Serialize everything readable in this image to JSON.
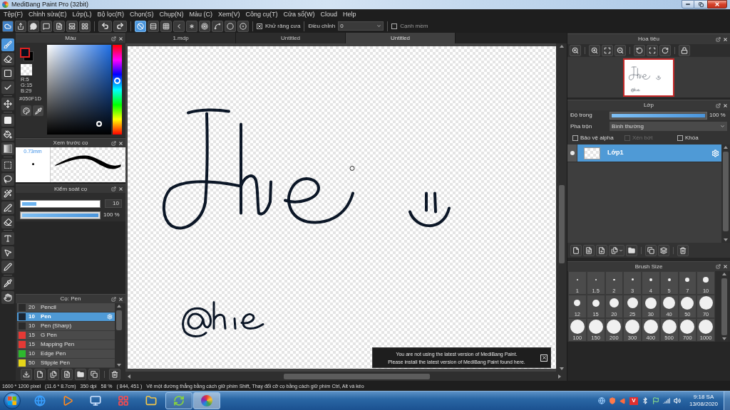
{
  "window": {
    "title": "MediBang Paint Pro (32bit)"
  },
  "menu": [
    "Tệp(F)",
    "Chỉnh sửa(E)",
    "Lớp(L)",
    "Bộ lọc(R)",
    "Chọn(S)",
    "Chụp(N)",
    "Màu (C)",
    "Xem(V)",
    "Công cụ(T)",
    "Cửa sổ(W)",
    "Cloud",
    "Help"
  ],
  "toolbar": {
    "snaps": [
      {
        "kind": "none",
        "selected": true
      },
      {
        "kind": "parallel",
        "selected": false
      },
      {
        "kind": "grid",
        "selected": false
      },
      {
        "kind": "perspective",
        "selected": false
      },
      {
        "kind": "radial",
        "selected": false
      },
      {
        "kind": "concentric",
        "selected": false
      },
      {
        "kind": "curve",
        "selected": false
      },
      {
        "kind": "circle",
        "selected": false
      },
      {
        "kind": "ellipse",
        "selected": false
      }
    ],
    "antialias": {
      "label": "Khử răng cưa",
      "checked": true
    },
    "correction": {
      "label": "Điều chỉnh",
      "value": "0"
    },
    "soft_edge": {
      "label": "Cạnh mềm",
      "checked": false
    }
  },
  "tool_groups": [
    [
      {
        "kind": "brush",
        "selected": true
      },
      {
        "kind": "eraser",
        "selected": false
      },
      {
        "kind": "dot",
        "selected": false
      },
      {
        "kind": "check",
        "selected": false
      }
    ],
    [
      {
        "kind": "move",
        "selected": false
      }
    ],
    [
      {
        "kind": "fill",
        "selected": false
      },
      {
        "kind": "bucket",
        "selected": false
      },
      {
        "kind": "gradient",
        "selected": false
      }
    ],
    [
      {
        "kind": "select",
        "selected": false
      },
      {
        "kind": "lasso",
        "selected": false
      },
      {
        "kind": "wand",
        "selected": false
      },
      {
        "kind": "select-pen",
        "selected": false
      },
      {
        "kind": "select-eraser",
        "selected": false
      }
    ],
    [
      {
        "kind": "text",
        "selected": false
      },
      {
        "kind": "pointer",
        "selected": false
      },
      {
        "kind": "pen",
        "selected": false
      }
    ],
    [
      {
        "kind": "eyedropper",
        "selected": false
      },
      {
        "kind": "hand",
        "selected": false
      }
    ]
  ],
  "color_panel": {
    "title": "Màu",
    "r": "R:5",
    "g": "G:15",
    "b": "B:29",
    "hex": "#050F1D",
    "hue_slider": {
      "level": 0.6
    }
  },
  "brush_preview": {
    "title": "Xem trước cọ",
    "size": "0.73mm"
  },
  "brush_control": {
    "title": "Kiểm soát cọ",
    "size": {
      "level": 0.19,
      "value": "10"
    },
    "opacity": {
      "level": 1,
      "reading": "100 %"
    }
  },
  "brush_list": {
    "title": "Cọ: Pen",
    "items": [
      {
        "size": "20",
        "name": "Pencil",
        "color": "#2b2b2b",
        "selected": false
      },
      {
        "size": "10",
        "name": "Pen",
        "color": "#1b2634",
        "selected": true
      },
      {
        "size": "10",
        "name": "Pen (Sharp)",
        "color": "#2b2b2b",
        "selected": false
      },
      {
        "size": "15",
        "name": "G Pen",
        "color": "#e53935",
        "selected": false
      },
      {
        "size": "15",
        "name": "Mapping Pen",
        "color": "#e53935",
        "selected": false
      },
      {
        "size": "10",
        "name": "Edge Pen",
        "color": "#2eb82e",
        "selected": false
      },
      {
        "size": "50",
        "name": "Stipple Pen",
        "color": "#e6d619",
        "selected": false
      }
    ]
  },
  "document_tabs": [
    {
      "label": "1.mdp",
      "selected": false
    },
    {
      "label": "Untitled",
      "selected": false
    },
    {
      "label": "Untitled",
      "selected": true
    }
  ],
  "notification": {
    "lines": [
      "You are not using the latest version of MediBang Paint.",
      "Please install the latest version of MediBang Paint found here."
    ]
  },
  "navigator": {
    "title": "Hoa tiêu"
  },
  "layer_panel": {
    "title": "Lớp",
    "opacity": {
      "label": "Độ trong",
      "level": 1,
      "reading": "100 %"
    },
    "blend": {
      "label": "Pha trộn",
      "value": "Bình thường"
    },
    "options": [
      {
        "label": "Bảo vệ alpha",
        "checked": false,
        "disabled": false
      },
      {
        "label": "Xén bớt",
        "checked": false,
        "disabled": true
      },
      {
        "label": "Khóa",
        "checked": false,
        "disabled": false
      }
    ],
    "layers": [
      {
        "name": "Lớp1",
        "selected": true,
        "visible": true
      }
    ]
  },
  "brush_size": {
    "title": "Brush Size",
    "sizes": [
      "1",
      "1.5",
      "2",
      "3",
      "4",
      "5",
      "7",
      "10",
      "12",
      "15",
      "20",
      "25",
      "30",
      "40",
      "50",
      "70",
      "100",
      "150",
      "200",
      "300",
      "400",
      "500",
      "700",
      "1000"
    ]
  },
  "status_bar": {
    "size": "1600 * 1200 pixel",
    "print_size": "(11.6 * 8.7cm)",
    "resolution": "350 dpi",
    "zoom": "58 %",
    "cursor": "( 844, 451 )",
    "hint": "Vẽ một đường thẳng bằng cách giữ phím Shift, Thay đổi cỡ cọ bằng cách giữ phím Ctrl, Alt và kéo"
  },
  "taskbar": {
    "apps": [
      {
        "kind": "browser",
        "running": false,
        "selected": false
      },
      {
        "kind": "media",
        "running": false,
        "selected": false
      },
      {
        "kind": "monitor",
        "running": false,
        "selected": false
      },
      {
        "kind": "grid",
        "running": false,
        "selected": false
      },
      {
        "kind": "folder",
        "running": false,
        "selected": false
      },
      {
        "kind": "refresh",
        "running": true,
        "selected": false
      },
      {
        "kind": "paint",
        "running": true,
        "selected": true
      }
    ],
    "tray_badge": "V",
    "time": "9:18 SA",
    "date": "13/08/2020"
  }
}
